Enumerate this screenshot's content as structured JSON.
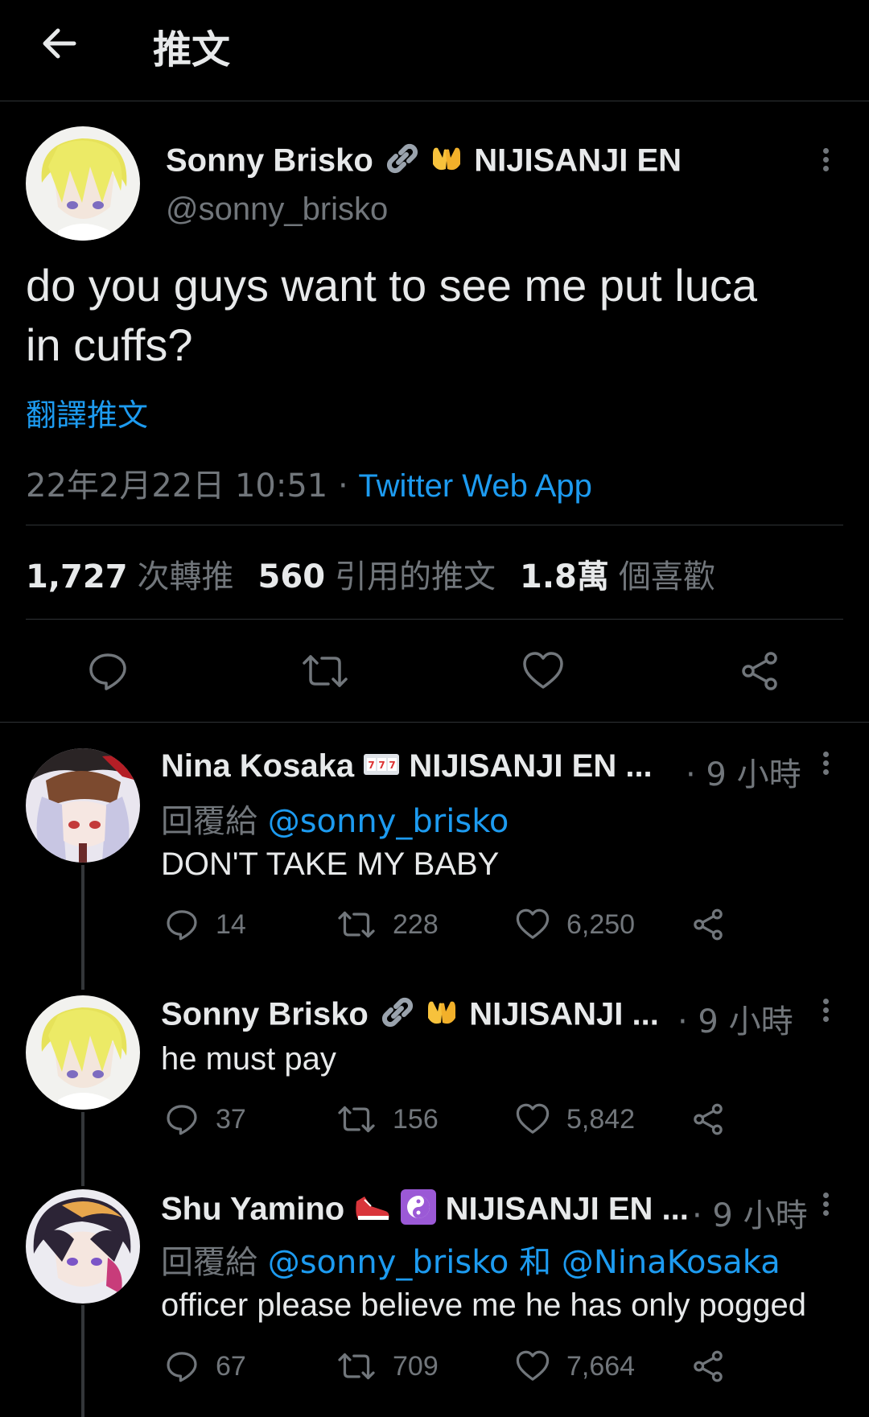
{
  "header": {
    "title": "推文"
  },
  "tweet": {
    "name": "Sonny Brisko",
    "org": "NIJISANJI EN",
    "handle": "@sonny_brisko",
    "text_line1": "do you guys want to see me put luca",
    "text_line2": "in cuffs?",
    "translate": "翻譯推文",
    "date": "22年2月22日 10:51 · ",
    "source": "Twitter Web App",
    "retweets_count": "1,727",
    "retweets_label": "次轉推",
    "quotes_count": "560",
    "quotes_label": "引用的推文",
    "likes_count": "1.8萬",
    "likes_label": "個喜歡"
  },
  "replies": [
    {
      "name": "Nina Kosaka",
      "org": "NIJISANJI EN ...",
      "time": "· 9 小時",
      "reply_prefix": "回覆給 ",
      "reply_to": "@sonny_brisko",
      "text": "DON'T TAKE MY BABY",
      "replies": "14",
      "retweets": "228",
      "likes": "6,250"
    },
    {
      "name": "Sonny Brisko",
      "org": "NIJISANJI ...",
      "time": "· 9 小時",
      "text": "he must pay",
      "replies": "37",
      "retweets": "156",
      "likes": "5,842"
    },
    {
      "name": "Shu Yamino",
      "org": "NIJISANJI EN ...",
      "time": "· 9 小時",
      "reply_prefix": "回覆給 ",
      "reply_to": "@sonny_brisko",
      "reply_and": " 和 ",
      "reply_to2": "@NinaKosaka",
      "text": "officer please believe me he has only pogged",
      "replies": "67",
      "retweets": "709",
      "likes": "7,664"
    }
  ],
  "colors": {
    "accent": "#1d9bf0",
    "muted": "#71767b",
    "text": "#e7e9ea",
    "background": "#000000"
  }
}
